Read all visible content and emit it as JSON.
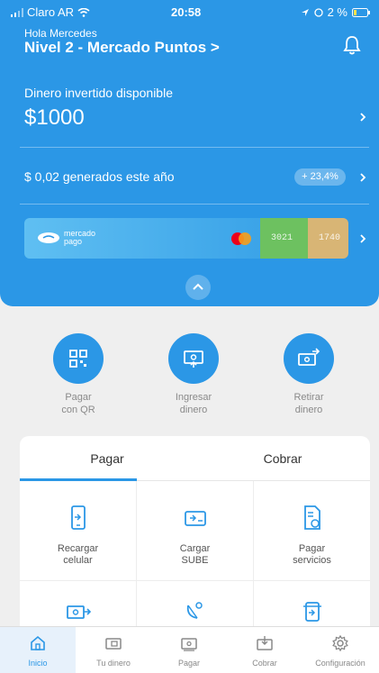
{
  "status_bar": {
    "carrier": "Claro AR",
    "time": "20:58",
    "battery": "2 %"
  },
  "header": {
    "greeting": "Hola Mercedes",
    "level": "Nivel 2 - Mercado Puntos >",
    "invested_label": "Dinero invertido disponible",
    "invested_amount": "$1000",
    "generated_label": "$ 0,02 generados este año",
    "generated_badge": "+ 23,4%"
  },
  "cards": {
    "brand_top": "mercado",
    "brand_bottom": "pago",
    "number_1": "3021",
    "number_2": "1740"
  },
  "actions": [
    {
      "label_1": "Pagar",
      "label_2": "con QR"
    },
    {
      "label_1": "Ingresar",
      "label_2": "dinero"
    },
    {
      "label_1": "Retirar",
      "label_2": "dinero"
    }
  ],
  "tabs": [
    {
      "label": "Pagar"
    },
    {
      "label": "Cobrar"
    }
  ],
  "services": [
    {
      "label_1": "Recargar",
      "label_2": "celular"
    },
    {
      "label_1": "Cargar",
      "label_2": "SUBE"
    },
    {
      "label_1": "Pagar",
      "label_2": "servicios"
    }
  ],
  "bottom_nav": [
    {
      "label": "Inicio"
    },
    {
      "label": "Tu dinero"
    },
    {
      "label": "Pagar"
    },
    {
      "label": "Cobrar"
    },
    {
      "label": "Configuración"
    }
  ],
  "colors": {
    "primary": "#2b97e6",
    "background": "#efefef"
  }
}
